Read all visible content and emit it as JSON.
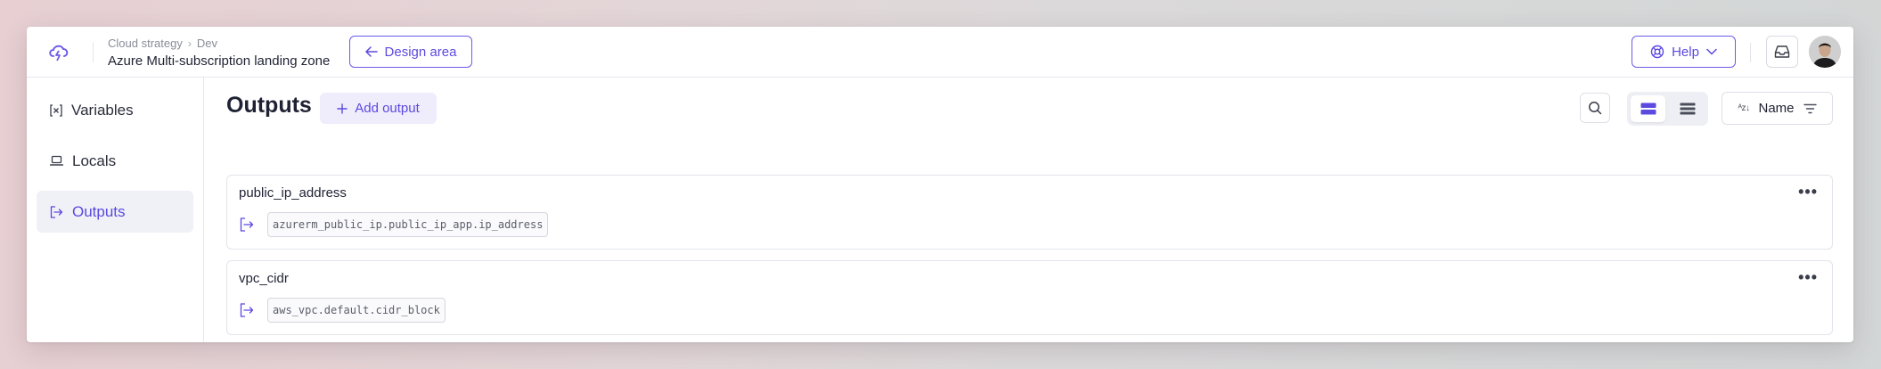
{
  "header": {
    "breadcrumb": [
      "Cloud strategy",
      "Dev"
    ],
    "breadcrumb_separator": "›",
    "title": "Azure Multi-subscription landing zone",
    "design_area_label": "Design area",
    "help_label": "Help"
  },
  "sidebar": {
    "items": [
      {
        "label": "Variables",
        "icon": "variables-icon",
        "active": false
      },
      {
        "label": "Locals",
        "icon": "laptop-icon",
        "active": false
      },
      {
        "label": "Outputs",
        "icon": "output-icon",
        "active": true
      }
    ]
  },
  "main": {
    "title": "Outputs",
    "add_label": "Add output",
    "sort_label": "Name",
    "sort_icon_text": "ᴬᴢ↓",
    "outputs": [
      {
        "name": "public_ip_address",
        "value": "azurerm_public_ip.public_ip_app.ip_address"
      },
      {
        "name": "vpc_cidr",
        "value": "aws_vpc.default.cidr_block"
      }
    ],
    "more_glyph": "•••"
  },
  "colors": {
    "accent": "#5b49e0",
    "active_bg": "#f0f1f6",
    "border": "#e3e4ea"
  }
}
